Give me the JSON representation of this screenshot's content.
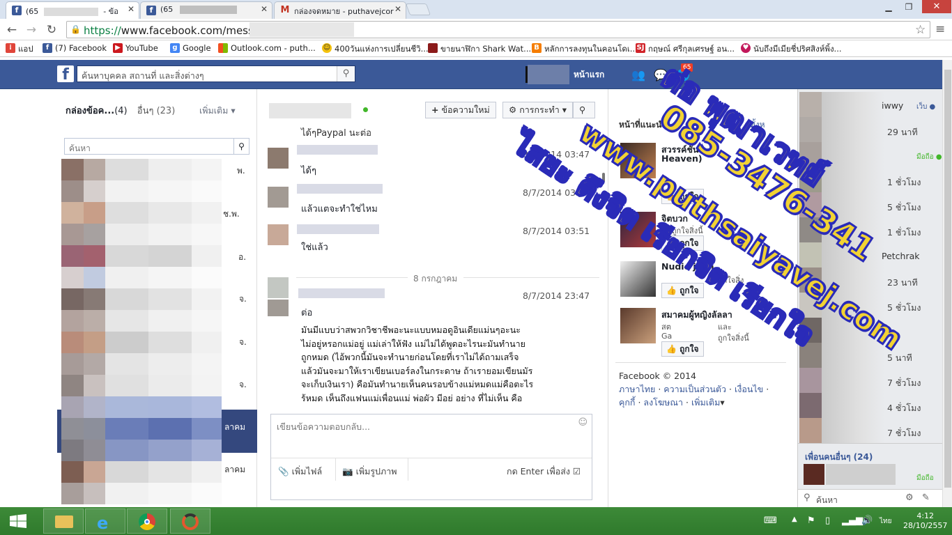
{
  "browser": {
    "tabs": [
      {
        "title": "(65",
        "suffix": "- ข้อ",
        "favicon": "facebook-icon"
      },
      {
        "title": "(65",
        "suffix": "",
        "favicon": "facebook-icon"
      },
      {
        "title": "กล่องจดหมาย - puthavejcor",
        "suffix": "",
        "favicon": "gmail-icon"
      }
    ],
    "url_prefix": "https://",
    "url_rest": "www.facebook.com/messa",
    "bookmarks": [
      {
        "label": "แอป",
        "icon": "apps-icon",
        "color": "#e0453a"
      },
      {
        "label": "(7) Facebook",
        "icon": "facebook-icon",
        "color": "#3b5998"
      },
      {
        "label": "YouTube",
        "icon": "youtube-icon",
        "color": "#cc181e"
      },
      {
        "label": "Google",
        "icon": "google-icon",
        "color": "#4285f4"
      },
      {
        "label": "Outlook.com - puth...",
        "icon": "windows-icon",
        "color": "#f25022"
      },
      {
        "label": "400วันแห่งการเปลี่ยนชีวิ...",
        "icon": "smiley-icon",
        "color": "#f4c20d"
      },
      {
        "label": "ขายนาฬิกา Shark Wat...",
        "icon": "shark-icon",
        "color": "#8b1a1a"
      },
      {
        "label": "หลักการลงทุนในคอนโดเ...",
        "icon": "blogger-icon",
        "color": "#f57d00"
      },
      {
        "label": "กฤษณ์ ศรีกุลเศรษฐ์ อน...",
        "icon": "sj-icon",
        "color": "#d1242a"
      },
      {
        "label": "นับถึงมีเมียชี่ปริศสิงห์พิ้ง...",
        "icon": "heart-icon",
        "color": "#c2185b"
      }
    ]
  },
  "fb": {
    "search_placeholder": "ค้นหาบุคคล สถานที่ และสิ่งต่างๆ",
    "home_label": "หน้าแรก",
    "notif_count": "65",
    "brand_color": "#3b5998"
  },
  "inbox": {
    "title": "กล่องข้อค...",
    "count": "(4)",
    "other_label": "อื่นๆ",
    "other_count": "(23)",
    "more_label": "เพิ่มเติม",
    "search_placeholder": "ค้นหา",
    "thread_dates": [
      "พ.",
      "ช.พ.",
      "อ.",
      "จ.",
      "จ.",
      "จ.",
      "ลาคม",
      "ลาคม"
    ]
  },
  "conversation": {
    "new_message_label": "ข้อความใหม่",
    "actions_label": "การกระทำ",
    "top_cut_text": "ได้ๆPaypal นะต่อ",
    "messages": [
      {
        "text": "ได้ๆ",
        "time": "8/7/2014 03:47"
      },
      {
        "text": "แล้วแตจะทำใช่ไหม",
        "time": "8/7/2014 03:4"
      },
      {
        "text": "ใช่แล้ว",
        "time": "8/7/2014 03:51"
      }
    ],
    "date_separator": "8 กรกฎาคม",
    "last_message": {
      "sender": "ต่อ",
      "time": "8/7/2014 23:47",
      "lines": [
        "มันมีแบบว่าสพวกวิชาชีพอะนะแบบหมอดูอินเดียแม่นๆอะนะ",
        "ไม่อยู่หรอกแม่อยู่ แม่เล่าให้ฟัง แม่ไม่ได้พูดอะไรนะมันทำนาย",
        "ถูกหมด (ไอ้พวกนี้มันจะทำนายก่อนโดยที่เราไม่ได้ถามเสร็จ",
        "แล้วมันจะมาให้เราเขียนเบอร์ลงในกระดาษ ถ้าเรายอมเขียนมัร",
        "จะเก็บเงินเรา) คือมันทำนายเห็นคนรอบข้างแม่หมดแม่คือตะไร",
        "รู้หมด เห็นถึงแฟนแม่เพื่อนแม่ พ่อผัว มีอยู่ อย่าง ที่ไม่เห็น คือ"
      ]
    },
    "reply_placeholder": "เขียนข้อความตอบกลับ...",
    "add_file_label": "เพิ่มไฟล์",
    "add_photo_label": "เพิ่มรูปภาพ",
    "enter_to_send_label": "กด Enter เพื่อส่ง"
  },
  "suggestions": {
    "header": "หน้าที่แนะนำ",
    "see_all": "ดูทั้งห",
    "items": [
      {
        "name": "สวรรค์ชั้นเจ",
        "name2": "Heaven)",
        "sub": "",
        "like": "ถูกใจ"
      },
      {
        "name": "จิตบวก",
        "name2": "",
        "sub": "คนถูกใจสิ่งนี้",
        "like": "ถูกใจ"
      },
      {
        "name": "Nudie jean",
        "name2": "",
        "sub": "ถูกใจสิ่ง",
        "like": "ถูกใจ"
      },
      {
        "name": "สมาคมผู้หญิงลัลลา",
        "name2": "",
        "sub": "สต",
        "sub2": "และ",
        "sub3": "Ga",
        "sub4": "ถูกใจสิ่งนี้",
        "like": "ถูกใจ"
      }
    ],
    "footer_copyright": "Facebook © 2014",
    "footer_links": [
      "ภาษาไทย",
      "ความเป็นส่วนตัว",
      "เงื่อนไข",
      "คุกกี้",
      "ลงโฆษณา",
      "เพิ่มเติม"
    ]
  },
  "chat": {
    "rows": [
      {
        "name": "iwwy",
        "time": "",
        "status": "เว็บ"
      },
      {
        "name": "",
        "time": "29 นาที",
        "status": ""
      },
      {
        "name": "",
        "time": "",
        "status": "มือถือ"
      },
      {
        "name": "",
        "time": "1 ชั่วโมง",
        "status": ""
      },
      {
        "name": "",
        "time": "5 ชั่วโมง",
        "status": ""
      },
      {
        "name": "",
        "time": "1 ชั่วโมง",
        "status": ""
      },
      {
        "name": "Petchrak",
        "time": "",
        "status": ""
      },
      {
        "name": "",
        "time": "23 นาที",
        "status": ""
      },
      {
        "name": "",
        "time": "5 ชั่วโมง",
        "status": ""
      },
      {
        "name": "ut",
        "time": "",
        "status": ""
      },
      {
        "name": "",
        "time": "5 นาที",
        "status": ""
      },
      {
        "name": "",
        "time": "7 ชั่วโมง",
        "status": ""
      },
      {
        "name": "",
        "time": "4 ชั่วโมง",
        "status": ""
      },
      {
        "name": "",
        "time": "7 ชั่วโมง",
        "status": ""
      }
    ],
    "more_friends": "เพื่อนคนอื่นๆ (24)",
    "more_status": "มือถือ",
    "search_placeholder": "ค้นหา"
  },
  "overlay": {
    "line1": "ต่อ พุฒาเวทย์",
    "line2": "085-3476-341",
    "line3": "www.puthsaiyavej.com",
    "line4": "ไสยะ ดึงจิต เรียกจิต เรียกใจ",
    "fill_color": "#f2d233",
    "stroke_color": "#2a2bb8"
  },
  "taskbar": {
    "time": "4:12",
    "date": "28/10/2557",
    "lang": "ไทย"
  }
}
